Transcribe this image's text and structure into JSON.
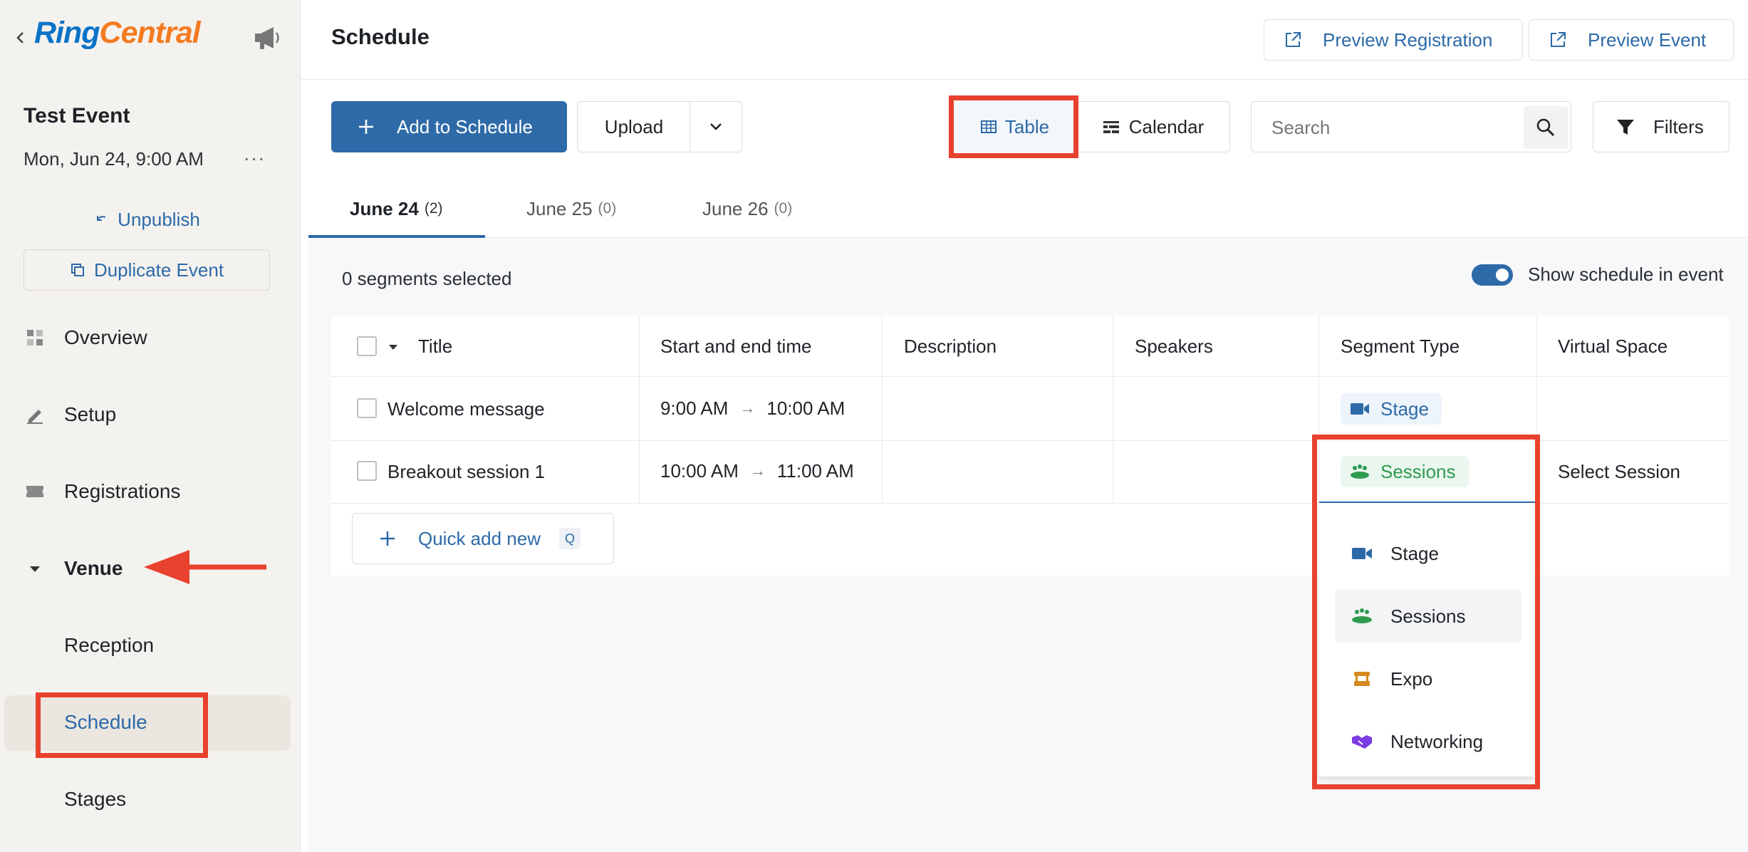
{
  "brand": {
    "ring": "Ring",
    "central": "Central"
  },
  "event": {
    "name": "Test Event",
    "date": "Mon, Jun 24, 9:00 AM",
    "more": "···"
  },
  "sidebar": {
    "unpublish": "Unpublish",
    "duplicate": "Duplicate Event",
    "items": [
      {
        "label": "Overview"
      },
      {
        "label": "Setup"
      },
      {
        "label": "Registrations"
      },
      {
        "label": "Venue"
      },
      {
        "label": "Reception"
      },
      {
        "label": "Schedule"
      },
      {
        "label": "Stages"
      }
    ]
  },
  "header": {
    "title": "Schedule",
    "preview_registration": "Preview Registration",
    "preview_event": "Preview Event"
  },
  "toolbar": {
    "add": "Add to Schedule",
    "upload": "Upload",
    "table": "Table",
    "calendar": "Calendar",
    "search_placeholder": "Search",
    "filters": "Filters"
  },
  "tabs": [
    {
      "label": "June 24",
      "count": "(2)"
    },
    {
      "label": "June 25",
      "count": "(0)"
    },
    {
      "label": "June 26",
      "count": "(0)"
    }
  ],
  "status": {
    "selected": "0 segments selected",
    "show_schedule": "Show schedule in event"
  },
  "table": {
    "columns": [
      "Title",
      "Start and end time",
      "Description",
      "Speakers",
      "Segment Type",
      "Virtual Space"
    ],
    "rows": [
      {
        "title": "Welcome message",
        "start": "9:00 AM",
        "end": "10:00 AM",
        "segment_type": "Stage",
        "virtual_space": ""
      },
      {
        "title": "Breakout session 1",
        "start": "10:00 AM",
        "end": "11:00 AM",
        "segment_type": "Sessions",
        "virtual_space": "Select Session"
      }
    ],
    "time_arrow": "→",
    "quick_add": "Quick add new",
    "quick_add_key": "Q"
  },
  "segment_dropdown": {
    "options": [
      "Stage",
      "Sessions",
      "Expo",
      "Networking"
    ],
    "hovered": "Sessions"
  },
  "colors": {
    "primary": "#2f6aa8",
    "ring_blue": "#0a73c7",
    "central_orange": "#f47b20",
    "stage_blue": "#2d6aa8",
    "sessions_green": "#2e9b4f",
    "expo_orange": "#d58a1f",
    "networking_purple": "#7a3be0",
    "annotation_red": "#e8412e"
  }
}
